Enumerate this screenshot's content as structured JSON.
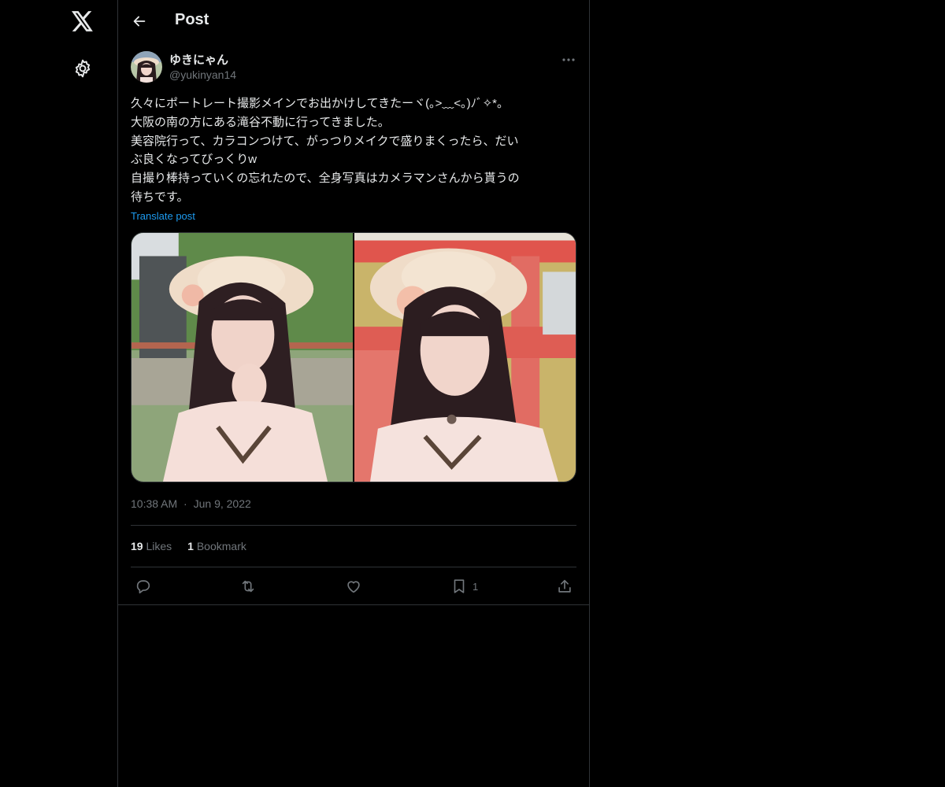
{
  "header": {
    "title": "Post",
    "back_icon": "arrow-left-icon"
  },
  "sidebar": {
    "logo_icon": "x-logo-icon",
    "settings_icon": "gear-icon"
  },
  "post": {
    "author": {
      "name": "ゆきにゃん",
      "handle": "@yukinyan14"
    },
    "text_lines": [
      "久々にポートレート撮影メインでお出かけしてきたーヾ(｡>﹏<｡)ﾉﾞ✧*。",
      "大阪の南の方にある滝谷不動に行ってきました。",
      "美容院行って、カラコンつけて、がっつりメイクで盛りまくったら、だい",
      "ぶ良くなってびっくりw",
      "自撮り棒持っていくの忘れたので、全身写真はカメラマンさんから貰うの",
      "待ちです。"
    ],
    "translate_label": "Translate post",
    "timestamp": {
      "time": "10:38 AM",
      "separator": "·",
      "date": "Jun 9, 2022"
    },
    "stats": {
      "likes_count": "19",
      "likes_label": "Likes",
      "bookmarks_count": "1",
      "bookmarks_label": "Bookmark"
    },
    "actions": {
      "reply_icon": "reply-icon",
      "repost_icon": "repost-icon",
      "like_icon": "heart-icon",
      "bookmark_icon": "bookmark-icon",
      "bookmark_count": "1",
      "share_icon": "share-icon"
    }
  },
  "colors": {
    "background": "#000000",
    "text": "#e7e9ea",
    "secondary": "#71767b",
    "link": "#1d9bf0",
    "border": "#2f3336"
  }
}
